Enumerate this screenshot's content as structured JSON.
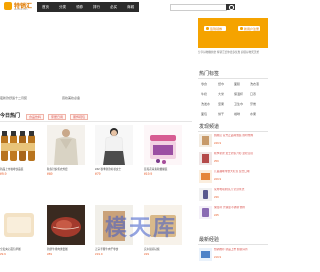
{
  "site": {
    "logo_text": "特销汇",
    "logo_sub": "tevuhui.com"
  },
  "nav": {
    "items": [
      "首页",
      "分类",
      "领券",
      "排行",
      "必买",
      "商城"
    ]
  },
  "left_texts": {
    "a": "夜新款舒适十二月装",
    "b": "眉妆美妆必备"
  },
  "hot_section": {
    "title": "今日热门",
    "tags": [
      "食品饮料",
      "家居日用",
      "服饰鞋包"
    ]
  },
  "products_row1": [
    {
      "title": "新品上市咖啡饮品装",
      "price": "¥9.9"
    },
    {
      "title": "秋冬针织毛衣外套",
      "price": "¥69"
    },
    {
      "title": "ZZZ 秋季新款衬衫女士",
      "price": "¥79"
    },
    {
      "title": "蓝莓花青素软糖罐装",
      "price": "¥19.9"
    }
  ],
  "products_row2": [
    {
      "title": "全麦夹心面包早餐",
      "price": "¥9.9"
    },
    {
      "title": "新鲜牛排肉类套餐",
      "price": "¥89"
    },
    {
      "title": "正宗手撕牛肉干零食",
      "price": "¥19.9"
    },
    {
      "title": "实木厨房砧板",
      "price": "¥29"
    }
  ],
  "sidebar": {
    "promo": {
      "btn1": "签到领券",
      "btn2": "新用户注册"
    },
    "promo_note": "分享好物赚佣金 特销汇给你更多优惠 超值好物天天抢",
    "hot_tags_title": "热门标签",
    "hot_tags": [
      [
        "零食",
        "纸巾",
        "面膜",
        "洗衣液"
      ],
      [
        "牛奶",
        "大米",
        "保温杯",
        "口罩"
      ],
      [
        "洗发水",
        "坚果",
        "卫生巾",
        "牙膏"
      ],
      [
        "面包",
        "饼干",
        "咖啡",
        "水果"
      ]
    ],
    "finds_title": "发现频道",
    "finds": [
      {
        "title": "旗舰店 官方正品特惠装 限时抢购",
        "price": "¥49.9"
      },
      {
        "title": "秋季新款 女士针织开衫 宽松百搭",
        "price": "¥59"
      },
      {
        "title": "儿童趣味零食大礼包 混合口味",
        "price": "¥29.9"
      },
      {
        "title": "家用电动剃须刀 全身水洗",
        "price": "¥39"
      },
      {
        "title": "保温杯 大容量不锈钢 便携",
        "price": "¥45"
      }
    ],
    "latest_title": "最新经验",
    "latest": [
      {
        "title": "热销推荐 新品上市 超值好价",
        "price": "¥19.9"
      }
    ]
  },
  "watermark": "模天库",
  "colors": {
    "brand": "#f5a300",
    "price": "#e85d2a",
    "nav_bg": "#2b2b2b"
  }
}
